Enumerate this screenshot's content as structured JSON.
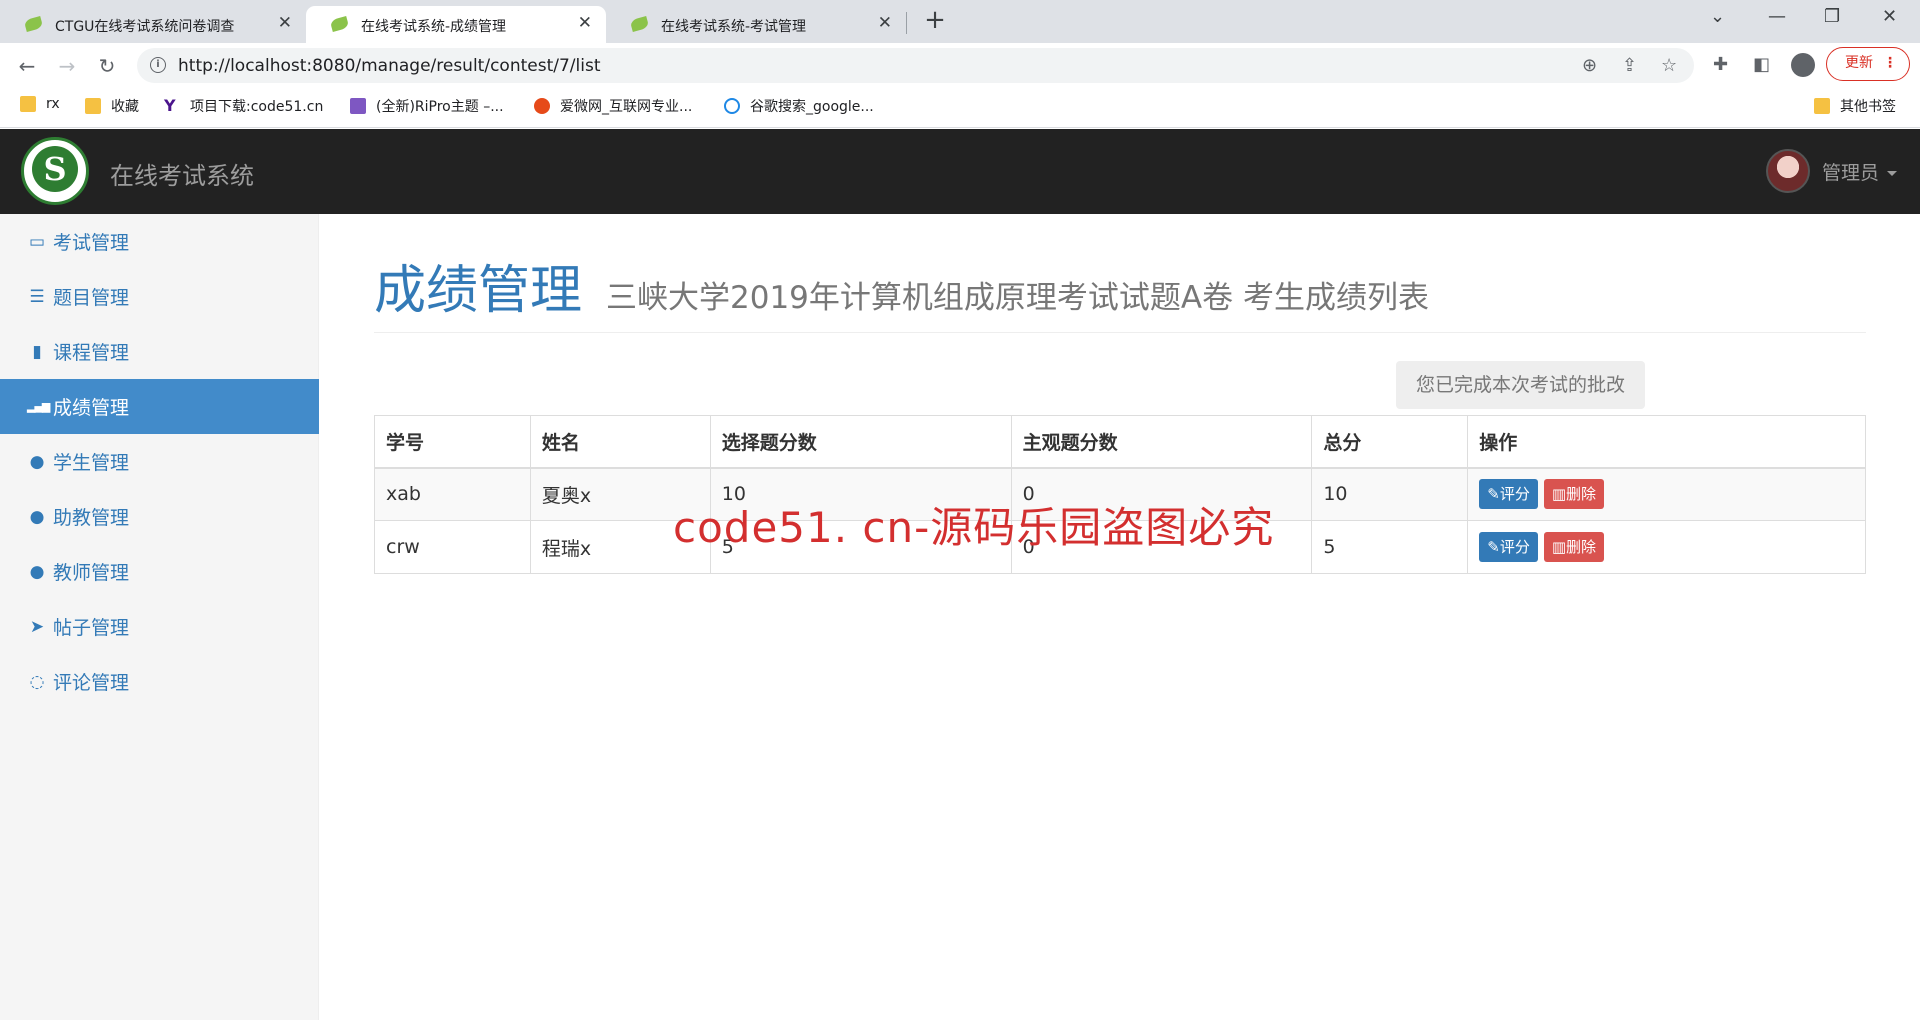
{
  "browser": {
    "tabs": [
      {
        "title": "CTGU在线考试系统问卷调查",
        "active": false
      },
      {
        "title": "在线考试系统-成绩管理",
        "active": true
      },
      {
        "title": "在线考试系统-考试管理",
        "active": false
      }
    ],
    "new_tab": "+",
    "url": "http://localhost:8080/manage/result/contest/7/list",
    "update_label": "更新",
    "bookmarks": [
      {
        "label": "rx",
        "icon": "folder-icon"
      },
      {
        "label": "收藏",
        "icon": "folder-icon"
      },
      {
        "label": "项目下载:code51.cn",
        "icon": "y-logo-icon"
      },
      {
        "label": "(全新)RiPro主题 –...",
        "icon": "ripro-icon"
      },
      {
        "label": "爱微网_互联网专业...",
        "icon": "aiwei-icon"
      },
      {
        "label": "谷歌搜索_google...",
        "icon": "360-icon"
      }
    ],
    "other_bookmarks": "其他书签"
  },
  "app": {
    "brand": "在线考试系统",
    "user": "管理员"
  },
  "sidebar": {
    "items": [
      {
        "label": "考试管理",
        "icon": "desktop-icon",
        "glyph": "▭",
        "active": false
      },
      {
        "label": "题目管理",
        "icon": "list-icon",
        "glyph": "☰",
        "active": false
      },
      {
        "label": "课程管理",
        "icon": "book-icon",
        "glyph": "▮",
        "active": false
      },
      {
        "label": "成绩管理",
        "icon": "signal-icon",
        "glyph": "▂▄▆",
        "active": true
      },
      {
        "label": "学生管理",
        "icon": "user-icon",
        "glyph": "●",
        "active": false
      },
      {
        "label": "助教管理",
        "icon": "user-icon",
        "glyph": "●",
        "active": false
      },
      {
        "label": "教师管理",
        "icon": "user-icon",
        "glyph": "●",
        "active": false
      },
      {
        "label": "帖子管理",
        "icon": "send-icon",
        "glyph": "➤",
        "active": false
      },
      {
        "label": "评论管理",
        "icon": "comment-icon",
        "glyph": "◌",
        "active": false
      }
    ]
  },
  "main": {
    "title": "成绩管理",
    "subtitle": "三峡大学2019年计算机组成原理考试试题A卷  考生成绩列表",
    "done_tip": "您已完成本次考试的批改",
    "table": {
      "headers": [
        "学号",
        "姓名",
        "选择题分数",
        "主观题分数",
        "总分",
        "操作"
      ],
      "rows": [
        {
          "id": "xab",
          "name": "夏奥x",
          "choice": "10",
          "subjective": "0",
          "total": "10"
        },
        {
          "id": "crw",
          "name": "程瑞x",
          "choice": "5",
          "subjective": "0",
          "total": "5"
        }
      ],
      "grade_label": "评分",
      "delete_label": "删除"
    }
  },
  "watermark": "code51. cn-源码乐园盗图必究"
}
